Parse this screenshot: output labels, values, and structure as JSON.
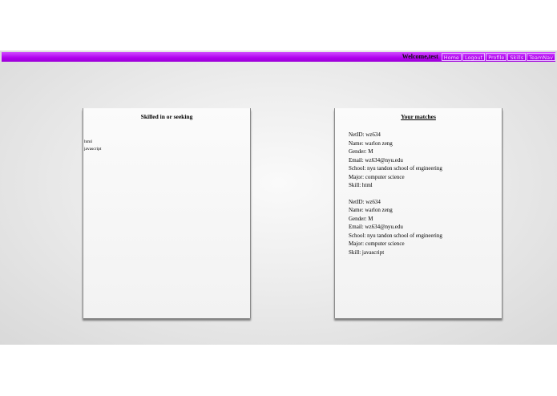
{
  "nav": {
    "welcome": "Welcome,test",
    "links": [
      "Home",
      "Logout",
      "Profile",
      "Skills",
      "TeamNav"
    ]
  },
  "skills_card": {
    "title": "Skilled in or seeking",
    "items": [
      "html",
      "javascript"
    ]
  },
  "matches_card": {
    "title": "Your matches",
    "matches": [
      {
        "netid": "NetID: wz634",
        "name": "Name: warlon zeng",
        "gender": "Gender: M",
        "email": "Email: wz634@nyu.edu",
        "school": "School: nyu tandon school of engineering",
        "major": "Major: computer science",
        "skill": "Skill: html"
      },
      {
        "netid": "NetID: wz634",
        "name": "Name: warlon zeng",
        "gender": "Gender: M",
        "email": "Email: wz634@nyu.edu",
        "school": "School: nyu tandon school of engineering",
        "major": "Major: computer science",
        "skill": "Skill: javascript"
      }
    ]
  },
  "colors": {
    "nav_bar": "#b000ee",
    "nav_link": "#f3d6ff"
  }
}
